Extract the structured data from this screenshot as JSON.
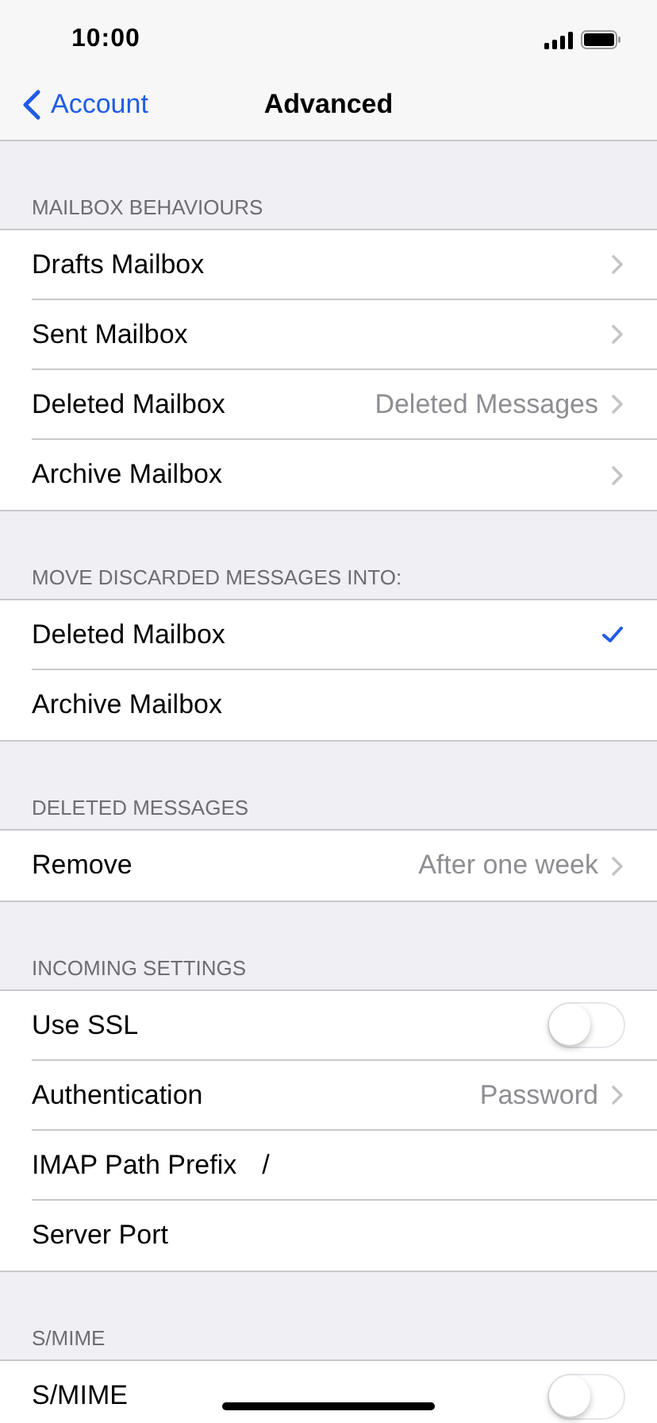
{
  "status_bar": {
    "time": "10:00"
  },
  "nav_bar": {
    "back": "Account",
    "title": "Advanced"
  },
  "sections": [
    {
      "header": "MAILBOX BEHAVIOURS",
      "rows": [
        {
          "kind": "disclosure",
          "label": "Drafts Mailbox"
        },
        {
          "kind": "disclosure",
          "label": "Sent Mailbox"
        },
        {
          "kind": "disclosure",
          "label": "Deleted Mailbox",
          "value": "Deleted Messages"
        },
        {
          "kind": "disclosure",
          "label": "Archive Mailbox"
        }
      ]
    },
    {
      "header": "MOVE DISCARDED MESSAGES INTO:",
      "rows": [
        {
          "kind": "check",
          "label": "Deleted Mailbox",
          "selected": true
        },
        {
          "kind": "check",
          "label": "Archive Mailbox",
          "selected": false
        }
      ]
    },
    {
      "header": "DELETED MESSAGES",
      "rows": [
        {
          "kind": "disclosure",
          "label": "Remove",
          "value": "After one week"
        }
      ]
    },
    {
      "header": "INCOMING SETTINGS",
      "rows": [
        {
          "kind": "toggle",
          "label": "Use SSL",
          "on": false
        },
        {
          "kind": "disclosure",
          "label": "Authentication",
          "value": "Password"
        },
        {
          "kind": "field",
          "label": "IMAP Path Prefix",
          "value": "/"
        },
        {
          "kind": "field",
          "label": "Server Port"
        }
      ]
    },
    {
      "header": "S/MIME",
      "rows": [
        {
          "kind": "toggle",
          "label": "S/MIME",
          "on": false
        }
      ]
    }
  ]
}
